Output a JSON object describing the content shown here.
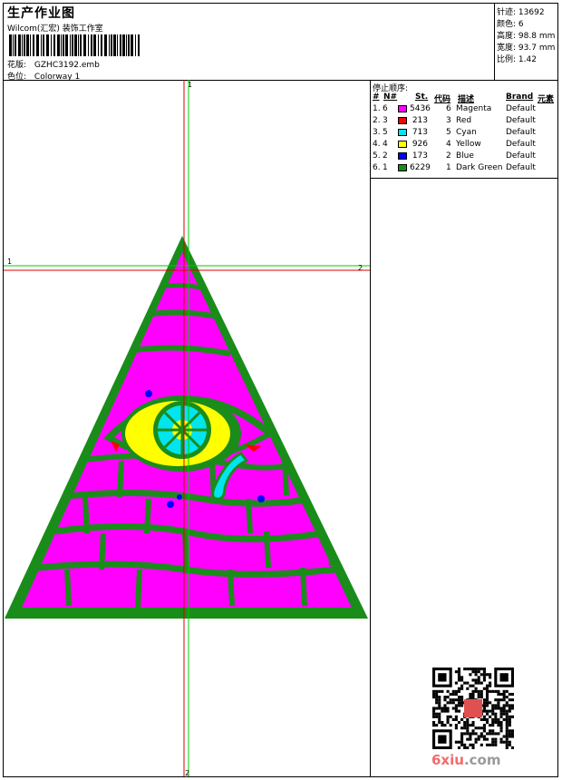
{
  "header": {
    "title": "生产作业图",
    "studio": "Wilcom(汇宏) 装饰工作室",
    "design_label": "花版:",
    "design_file": "GZHC3192.emb",
    "colorway_label": "色位:",
    "colorway": "Colorway 1"
  },
  "stats": [
    {
      "label": "针迹:",
      "value": "13692"
    },
    {
      "label": "颜色:",
      "value": "6"
    },
    {
      "label": "高度:",
      "value": "98.8 mm"
    },
    {
      "label": "宽度:",
      "value": "93.7 mm"
    },
    {
      "label": "比例:",
      "value": "1.42"
    }
  ],
  "sequence": {
    "title": "停止顺序:",
    "headers": {
      "num": "#",
      "n": "N#",
      "st": "St.",
      "code": "代码",
      "desc": "描述",
      "brand": "Brand",
      "element": "元素"
    },
    "rows": [
      {
        "idx": "1.",
        "n": "6",
        "color": "#ff00ff",
        "st": "5436",
        "code": "6",
        "desc": "Magenta",
        "brand": "Default"
      },
      {
        "idx": "2.",
        "n": "3",
        "color": "#ff0000",
        "st": "213",
        "code": "3",
        "desc": "Red",
        "brand": "Default"
      },
      {
        "idx": "3.",
        "n": "5",
        "color": "#00e5ee",
        "st": "713",
        "code": "5",
        "desc": "Cyan",
        "brand": "Default"
      },
      {
        "idx": "4.",
        "n": "4",
        "color": "#ffff00",
        "st": "926",
        "code": "4",
        "desc": "Yellow",
        "brand": "Default"
      },
      {
        "idx": "5.",
        "n": "2",
        "color": "#0000ff",
        "st": "173",
        "code": "2",
        "desc": "Blue",
        "brand": "Default"
      },
      {
        "idx": "6.",
        "n": "1",
        "color": "#1a8c1a",
        "st": "6229",
        "code": "1",
        "desc": "Dark Green",
        "brand": "Default"
      }
    ]
  },
  "guides": {
    "top_label": "1",
    "bottom_label": "2",
    "left_label": "1",
    "right_label": "2"
  },
  "watermark": {
    "text": "6xiu",
    "domain": ".com"
  },
  "colors": {
    "magenta": "#ff00ff",
    "green": "#1a8c1a",
    "yellow": "#ffff00",
    "cyan": "#00e5ee",
    "blue": "#0000ff",
    "red": "#ff0000",
    "guide_green": "#00cc00",
    "guide_red": "#dd0000"
  }
}
